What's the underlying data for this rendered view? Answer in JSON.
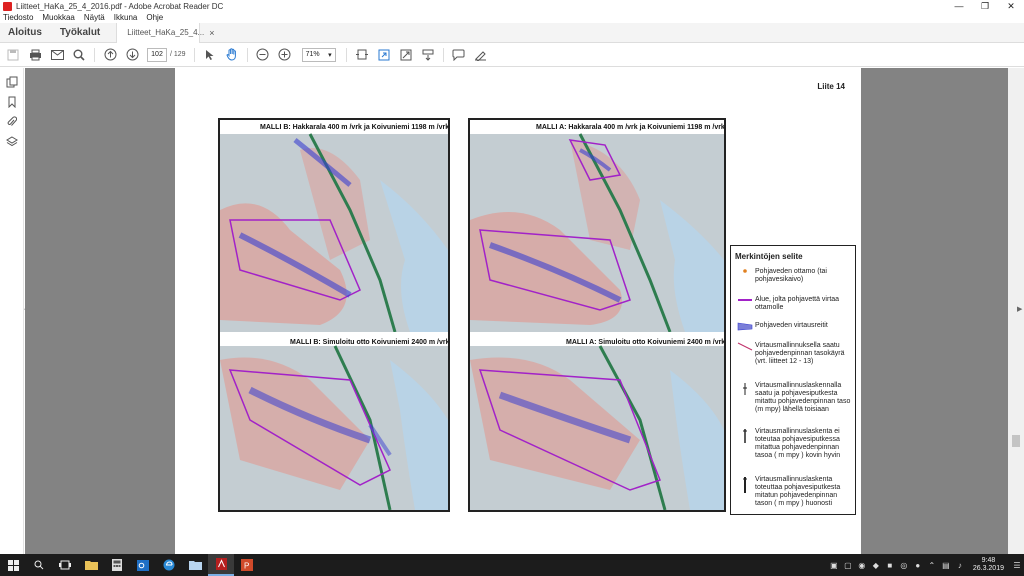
{
  "window": {
    "title": "Liitteet_HaKa_25_4_2016.pdf - Adobe Acrobat Reader DC",
    "minimize": "—",
    "restore": "❐",
    "close": "✕"
  },
  "menu": [
    "Tiedosto",
    "Muokkaa",
    "Näytä",
    "Ikkuna",
    "Ohje"
  ],
  "tabs": {
    "home": "Aloitus",
    "tools": "Työkalut",
    "document": "Liitteet_HaKa_25_4...",
    "close": "×"
  },
  "toolbar": {
    "page_current": "102",
    "page_total": "/ 129",
    "zoom": "71%",
    "zoom_caret": "▾",
    "icons": [
      "save-icon",
      "print-icon",
      "email-icon",
      "search-icon",
      "page-up-icon",
      "page-down-icon",
      "select-arrow-icon",
      "hand-icon",
      "zoom-out-icon",
      "zoom-in-icon",
      "fit-page-icon",
      "rotate-icon",
      "fullscreen-icon",
      "scroll-mode-icon",
      "comment-icon",
      "sign-icon"
    ]
  },
  "document": {
    "page_label": "Liite 14",
    "maps": {
      "top_left": "MALLI B: Hakkarala 400 m /vrk ja Koivuniemi 1198 m /vrk",
      "top_right": "MALLI A: Hakkarala 400 m /vrk ja Koivuniemi 1198 m /vrk",
      "bottom_left": "MALLI B: Simuloitu otto Koivuniemi 2400 m /vrk",
      "bottom_right": "MALLI A: Simuloitu otto Koivuniemi 2400 m /vrk"
    },
    "map_colors": {
      "terrain": "#d8a8a4",
      "water": "#b9d3e6",
      "area_line": "#a222c8",
      "flow": "#3a40d0",
      "road": "#2e7d4f"
    },
    "legend": {
      "title": "Merkintöjen selite",
      "items": [
        "Pohjaveden ottamo (tai pohjavesikaivo)",
        "Alue, jolta pohjavettä virtaa ottamolle",
        "Pohjaveden virtausreitit",
        "Virtausmallinnuksella saatu pohjavedenpinnan tasokäyrä (vrt. liitteet 12 - 13)",
        "Virtausmallinnuslaskennalla saatu ja pohjavesiputkesta mitattu pohjavedenpinnan taso (m mpy) lähellä toisiaan",
        "Virtausmallinnuslaskenta ei toteutaa pohjavesiputkessa mitattua pohjavedenpinnan tasoa ( m mpy ) kovin hyvin",
        "Virtausmallinnuslaskenta toteuttaa pohjavesiputkesta mitatun pohjavedenpinnan tason ( m mpy ) huonosti"
      ]
    }
  },
  "taskbar": {
    "time": "9:48",
    "date": "26.3.2019"
  }
}
